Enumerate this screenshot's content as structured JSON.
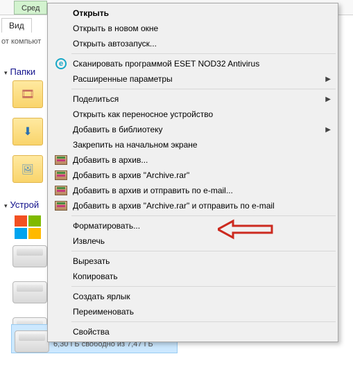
{
  "toolbar": {
    "button": "Сред"
  },
  "tab": {
    "view": "Вид"
  },
  "breadcrumb": "от компьют",
  "sections": {
    "folders": "Папки",
    "devices": "Устрой"
  },
  "selected_drive": {
    "capacity_text": "6,30 ГБ свободно из 7,47 ГБ"
  },
  "menu": {
    "open": "Открыть",
    "open_new_window": "Открыть в новом окне",
    "open_autoplay": "Открыть автозапуск...",
    "eset_scan": "Сканировать программой ESET NOD32 Antivirus",
    "advanced": "Расширенные параметры",
    "share": "Поделиться",
    "open_portable": "Открыть как переносное устройство",
    "add_to_library": "Добавить в библиотеку",
    "pin_start": "Закрепить на начальном экране",
    "add_archive": "Добавить в архив...",
    "add_archive_rar": "Добавить в архив \"Archive.rar\"",
    "add_archive_email": "Добавить в архив и отправить по e-mail...",
    "add_archive_rar_email": "Добавить в архив \"Archive.rar\" и отправить по e-mail",
    "format": "Форматировать...",
    "eject": "Извлечь",
    "cut": "Вырезать",
    "copy": "Копировать",
    "create_shortcut": "Создать ярлык",
    "rename": "Переименовать",
    "properties": "Свойства"
  }
}
